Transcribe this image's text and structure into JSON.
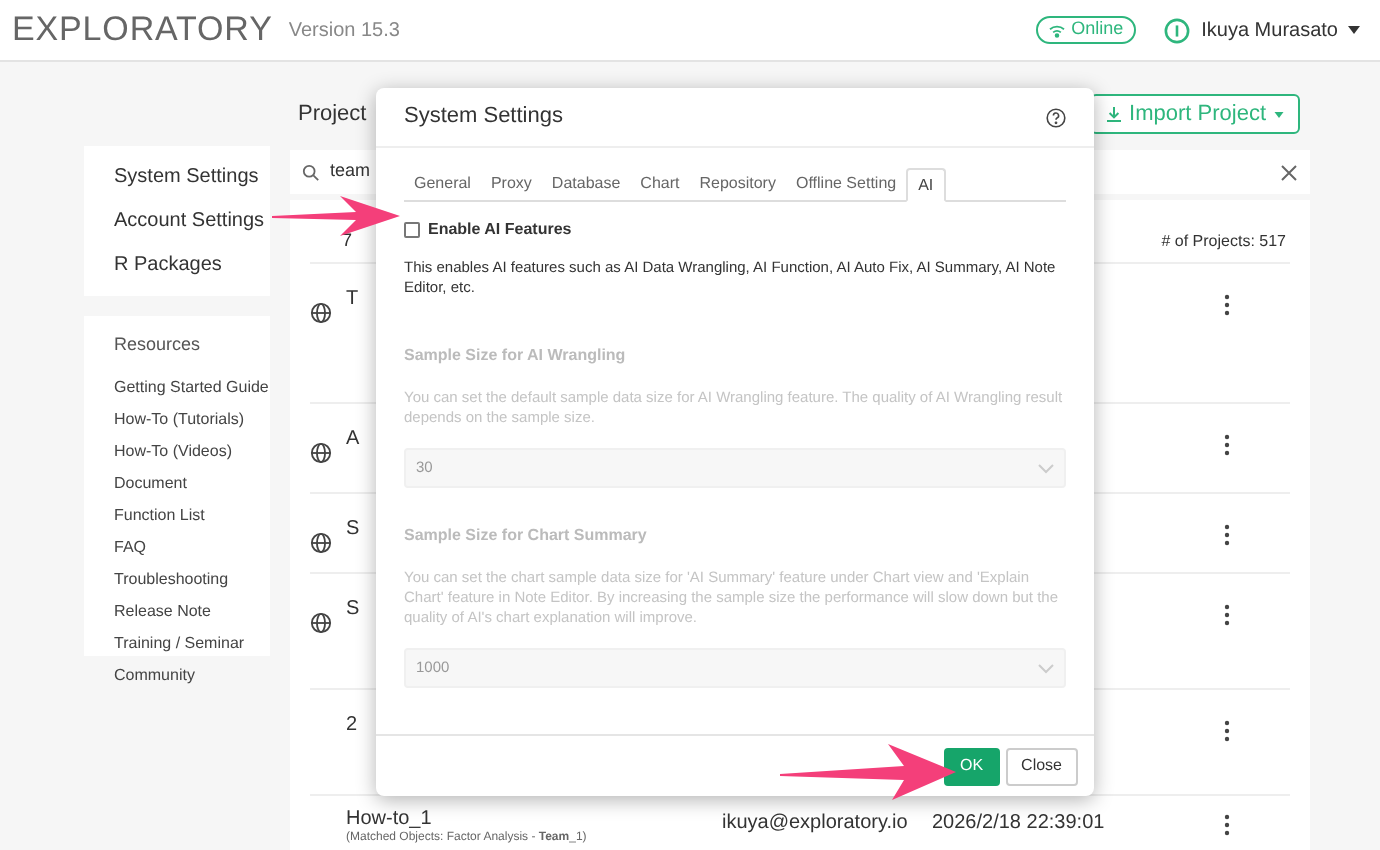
{
  "header": {
    "logo": "EXPLORATORY",
    "version": "Version 15.3",
    "status": "Online",
    "user": "Ikuya Murasato"
  },
  "sidebar": {
    "items": [
      {
        "label": "System Settings"
      },
      {
        "label": "Account Settings"
      },
      {
        "label": "R Packages"
      }
    ],
    "resources": {
      "title": "Resources",
      "items": [
        "Getting Started Guide",
        "How-To (Tutorials)",
        "How-To (Videos)",
        "Document",
        "Function List",
        "FAQ",
        "Troubleshooting",
        "Release Note",
        "Training / Seminar",
        "Community"
      ]
    }
  },
  "projects": {
    "title": "Project",
    "import_button": "Import Project",
    "search": {
      "value": "team"
    },
    "count": "# of Projects: 517",
    "header_mark": "7",
    "rows": [
      {
        "name": "T",
        "public": true
      },
      {
        "name": "A",
        "public": true
      },
      {
        "name": "S",
        "public": true
      },
      {
        "name": "S",
        "public": true
      },
      {
        "name": "2",
        "public": false
      },
      {
        "name": "How-to_1",
        "public": false,
        "matched": "(Matched Objects: Factor Analysis - **Team**_1)",
        "owner": "ikuya@exploratory.io",
        "updated": "2026/2/18 22:39:01"
      }
    ]
  },
  "dialog": {
    "title": "System Settings",
    "tabs": [
      {
        "label": "General",
        "selected": false
      },
      {
        "label": "Proxy",
        "selected": false
      },
      {
        "label": "Database",
        "selected": false
      },
      {
        "label": "Chart",
        "selected": false
      },
      {
        "label": "Repository",
        "selected": false
      },
      {
        "label": "Offline Setting",
        "selected": false
      },
      {
        "label": "AI",
        "selected": true
      }
    ],
    "enable": {
      "label": "Enable AI Features",
      "checked": false,
      "description": "This enables AI features such as AI Data Wrangling, AI Function, AI Auto Fix, AI Summary, AI Note Editor, etc."
    },
    "sections": [
      {
        "title": "Sample Size for AI Wrangling",
        "description": "You can set the default sample data size for AI Wrangling feature. The quality of AI Wrangling result depends on the sample size.",
        "value": "30",
        "disabled": true
      },
      {
        "title": "Sample Size for Chart Summary",
        "description": "You can set the chart sample data size for 'AI Summary' feature under Chart view and 'Explain Chart' feature in Note Editor. By increasing the sample size the performance will slow down but the quality of AI's chart explanation will improve.",
        "value": "1000",
        "disabled": true
      }
    ],
    "buttons": [
      {
        "label": "OK",
        "kind": "primary"
      },
      {
        "label": "Close",
        "kind": "default"
      }
    ]
  }
}
